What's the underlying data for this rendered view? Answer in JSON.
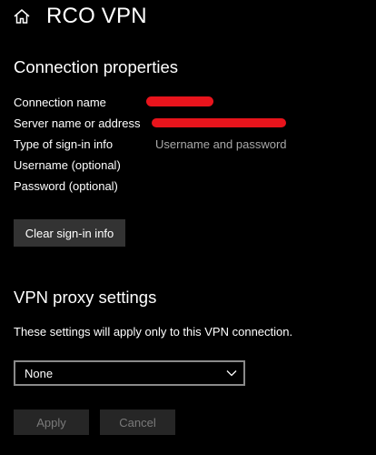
{
  "header": {
    "icon": "home-icon",
    "title": "RCO VPN"
  },
  "connection_properties": {
    "title": "Connection properties",
    "rows": [
      {
        "label": "Connection name",
        "value": null,
        "redacted": true
      },
      {
        "label": "Server name or address",
        "value": null,
        "redacted": true
      },
      {
        "label": "Type of sign-in info",
        "value": "Username and password",
        "redacted": false
      },
      {
        "label": "Username (optional)",
        "value": "",
        "redacted": false
      },
      {
        "label": "Password (optional)",
        "value": "",
        "redacted": false
      }
    ],
    "clear_button_label": "Clear sign-in info"
  },
  "proxy": {
    "title": "VPN proxy settings",
    "description": "These settings will apply only to this VPN connection.",
    "selected_option": "None"
  },
  "footer": {
    "apply_label": "Apply",
    "cancel_label": "Cancel"
  },
  "colors": {
    "background": "#000000",
    "text": "#ffffff",
    "value_text": "#a8a8a8",
    "redaction": "#e8141c",
    "button_bg": "#333333",
    "disabled_bg": "#262626",
    "disabled_text": "#7a7a7a"
  }
}
